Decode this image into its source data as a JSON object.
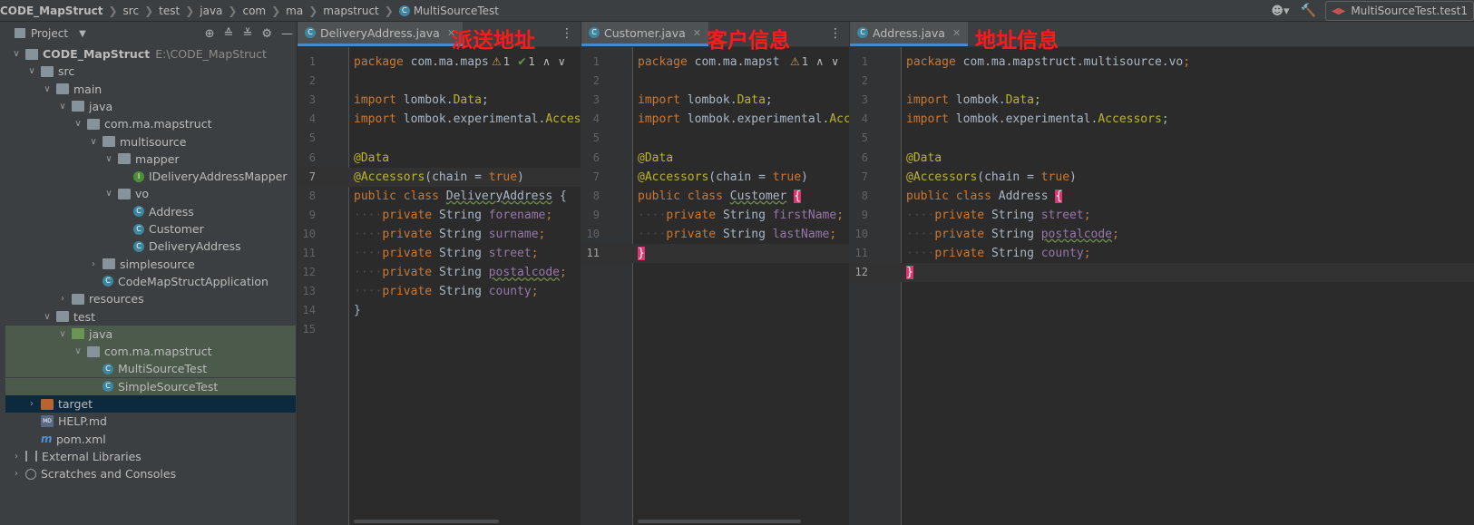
{
  "breadcrumbs": [
    "CODE_MapStruct",
    "src",
    "test",
    "java",
    "com",
    "ma",
    "mapstruct",
    "MultiSourceTest"
  ],
  "run_config": "MultiSourceTest.test1",
  "project_panel": {
    "title": "Project",
    "tree": [
      {
        "label": "CODE_MapStruct",
        "extra": "E:\\CODE_MapStruct",
        "depth": 0,
        "icon": "folder",
        "arrow": "down",
        "bold": true
      },
      {
        "label": "src",
        "depth": 1,
        "icon": "folder",
        "arrow": "down"
      },
      {
        "label": "main",
        "depth": 2,
        "icon": "folder",
        "arrow": "down"
      },
      {
        "label": "java",
        "depth": 3,
        "icon": "folder-blue",
        "arrow": "down"
      },
      {
        "label": "com.ma.mapstruct",
        "depth": 4,
        "icon": "package",
        "arrow": "down"
      },
      {
        "label": "multisource",
        "depth": 5,
        "icon": "package",
        "arrow": "down"
      },
      {
        "label": "mapper",
        "depth": 6,
        "icon": "package",
        "arrow": "down"
      },
      {
        "label": "IDeliveryAddressMapper",
        "depth": 7,
        "icon": "interface",
        "arrow": ""
      },
      {
        "label": "vo",
        "depth": 6,
        "icon": "package",
        "arrow": "down"
      },
      {
        "label": "Address",
        "depth": 7,
        "icon": "class",
        "arrow": ""
      },
      {
        "label": "Customer",
        "depth": 7,
        "icon": "class",
        "arrow": ""
      },
      {
        "label": "DeliveryAddress",
        "depth": 7,
        "icon": "class",
        "arrow": ""
      },
      {
        "label": "simplesource",
        "depth": 5,
        "icon": "package",
        "arrow": "right"
      },
      {
        "label": "CodeMapStructApplication",
        "depth": 5,
        "icon": "class-app",
        "arrow": ""
      },
      {
        "label": "resources",
        "depth": 3,
        "icon": "folder-res",
        "arrow": "right"
      },
      {
        "label": "test",
        "depth": 2,
        "icon": "folder",
        "arrow": "down"
      },
      {
        "label": "java",
        "depth": 3,
        "icon": "folder-green",
        "arrow": "down",
        "state": "selected"
      },
      {
        "label": "com.ma.mapstruct",
        "depth": 4,
        "icon": "package",
        "arrow": "down",
        "state": "selected"
      },
      {
        "label": "MultiSourceTest",
        "depth": 5,
        "icon": "class-test",
        "arrow": "",
        "state": "selected"
      },
      {
        "label": "SimpleSourceTest",
        "depth": 5,
        "icon": "class-test",
        "arrow": "",
        "state": "selected"
      },
      {
        "label": "target",
        "depth": 1,
        "icon": "folder-orange",
        "arrow": "right",
        "state": "focused"
      },
      {
        "label": "HELP.md",
        "depth": 1,
        "icon": "markdown",
        "arrow": ""
      },
      {
        "label": "pom.xml",
        "depth": 1,
        "icon": "maven",
        "arrow": ""
      },
      {
        "label": "External Libraries",
        "depth": 0,
        "icon": "library",
        "arrow": "right"
      },
      {
        "label": "Scratches and Consoles",
        "depth": 0,
        "icon": "scratch",
        "arrow": "right"
      }
    ]
  },
  "editors": [
    {
      "tab": "DeliveryAddress.java",
      "note": "派送地址",
      "line_numbers": [
        "1",
        "2",
        "3",
        "4",
        "5",
        "6",
        "7",
        "8",
        "9",
        "10",
        "11",
        "12",
        "13",
        "14",
        "15"
      ],
      "current_line": "7",
      "inspection": {
        "warnings": "1",
        "ok": "1"
      },
      "lines": [
        [
          [
            "kw",
            "package "
          ],
          [
            "pl",
            "com.ma.maps"
          ]
        ],
        [],
        [
          [
            "kw",
            "import "
          ],
          [
            "pl",
            "lombok."
          ],
          [
            "an",
            "Data"
          ],
          [
            "pl",
            ";"
          ]
        ],
        [
          [
            "kw",
            "import "
          ],
          [
            "pl",
            "lombok.experimental."
          ],
          [
            "an",
            "Accessors"
          ],
          [
            "pl",
            ";"
          ]
        ],
        [],
        [
          [
            "an",
            "@Data"
          ]
        ],
        [
          [
            "an",
            "@Accessors"
          ],
          [
            "pl",
            "(chain = "
          ],
          [
            "kw",
            "true"
          ],
          [
            "pl",
            ")"
          ]
        ],
        [
          [
            "kw",
            "public class "
          ],
          [
            "pl-ul",
            "DeliveryAddress"
          ],
          [
            "pl",
            " {"
          ]
        ],
        [
          [
            "ws",
            "····"
          ],
          [
            "kw",
            "private "
          ],
          [
            "pl",
            "String "
          ],
          [
            "fld",
            "forename"
          ],
          [
            "kw",
            ";"
          ]
        ],
        [
          [
            "ws",
            "····"
          ],
          [
            "kw",
            "private "
          ],
          [
            "pl",
            "String "
          ],
          [
            "fld",
            "surname"
          ],
          [
            "kw",
            ";"
          ]
        ],
        [
          [
            "ws",
            "····"
          ],
          [
            "kw",
            "private "
          ],
          [
            "pl",
            "String "
          ],
          [
            "fld",
            "street"
          ],
          [
            "kw",
            ";"
          ]
        ],
        [
          [
            "ws",
            "····"
          ],
          [
            "kw",
            "private "
          ],
          [
            "pl",
            "String "
          ],
          [
            "fld-ul",
            "postalcode"
          ],
          [
            "kw",
            ";"
          ]
        ],
        [
          [
            "ws",
            "····"
          ],
          [
            "kw",
            "private "
          ],
          [
            "pl",
            "String "
          ],
          [
            "fld",
            "county"
          ],
          [
            "kw",
            ";"
          ]
        ],
        [
          [
            "pl",
            "}"
          ]
        ],
        []
      ]
    },
    {
      "tab": "Customer.java",
      "note": "客户信息",
      "line_numbers": [
        "1",
        "2",
        "3",
        "4",
        "5",
        "6",
        "7",
        "8",
        "9",
        "10",
        "11"
      ],
      "current_line": "11",
      "inspection": {
        "warnings": "1",
        "ok": ""
      },
      "lines": [
        [
          [
            "kw",
            "package "
          ],
          [
            "pl",
            "com.ma.mapst"
          ]
        ],
        [],
        [
          [
            "kw",
            "import "
          ],
          [
            "pl",
            "lombok."
          ],
          [
            "an",
            "Data"
          ],
          [
            "pl",
            ";"
          ]
        ],
        [
          [
            "kw",
            "import "
          ],
          [
            "pl",
            "lombok.experimental."
          ],
          [
            "an",
            "Acc"
          ]
        ],
        [],
        [
          [
            "an",
            "@Data"
          ]
        ],
        [
          [
            "an",
            "@Accessors"
          ],
          [
            "pl",
            "(chain = "
          ],
          [
            "kw",
            "true"
          ],
          [
            "pl",
            ")"
          ]
        ],
        [
          [
            "kw",
            "public class "
          ],
          [
            "pl-ul",
            "Customer"
          ],
          [
            "pl",
            " "
          ],
          [
            "brace",
            "{"
          ]
        ],
        [
          [
            "ws",
            "····"
          ],
          [
            "kw",
            "private "
          ],
          [
            "pl",
            "String "
          ],
          [
            "fld",
            "firstName"
          ],
          [
            "kw",
            ";"
          ]
        ],
        [
          [
            "ws",
            "····"
          ],
          [
            "kw",
            "private "
          ],
          [
            "pl",
            "String "
          ],
          [
            "fld",
            "lastName"
          ],
          [
            "kw",
            ";"
          ]
        ],
        [
          [
            "brace",
            "}"
          ]
        ]
      ]
    },
    {
      "tab": "Address.java",
      "note": "地址信息",
      "line_numbers": [
        "1",
        "2",
        "3",
        "4",
        "5",
        "6",
        "7",
        "8",
        "9",
        "10",
        "11",
        "12"
      ],
      "current_line": "12",
      "inspection": {
        "warnings": "",
        "ok": ""
      },
      "lines": [
        [
          [
            "kw",
            "package "
          ],
          [
            "pl",
            "com.ma.mapstruct.multisource.vo"
          ],
          [
            "kw",
            ";"
          ]
        ],
        [],
        [
          [
            "kw",
            "import "
          ],
          [
            "pl",
            "lombok."
          ],
          [
            "an",
            "Data"
          ],
          [
            "pl",
            ";"
          ]
        ],
        [
          [
            "kw",
            "import "
          ],
          [
            "pl",
            "lombok.experimental."
          ],
          [
            "an",
            "Accessors"
          ],
          [
            "pl",
            ";"
          ]
        ],
        [],
        [
          [
            "an",
            "@Data"
          ]
        ],
        [
          [
            "an",
            "@Accessors"
          ],
          [
            "pl",
            "(chain = "
          ],
          [
            "kw",
            "true"
          ],
          [
            "pl",
            ")"
          ]
        ],
        [
          [
            "kw",
            "public class "
          ],
          [
            "pl",
            "Address "
          ],
          [
            "brace",
            "{"
          ]
        ],
        [
          [
            "ws",
            "····"
          ],
          [
            "kw",
            "private "
          ],
          [
            "pl",
            "String "
          ],
          [
            "fld",
            "street"
          ],
          [
            "kw",
            ";"
          ]
        ],
        [
          [
            "ws",
            "····"
          ],
          [
            "kw",
            "private "
          ],
          [
            "pl",
            "String "
          ],
          [
            "fld-ul",
            "postalcode"
          ],
          [
            "kw",
            ";"
          ]
        ],
        [
          [
            "ws",
            "····"
          ],
          [
            "kw",
            "private "
          ],
          [
            "pl",
            "String "
          ],
          [
            "fld",
            "county"
          ],
          [
            "kw",
            ";"
          ]
        ],
        [
          [
            "brace",
            "}"
          ]
        ]
      ]
    }
  ]
}
